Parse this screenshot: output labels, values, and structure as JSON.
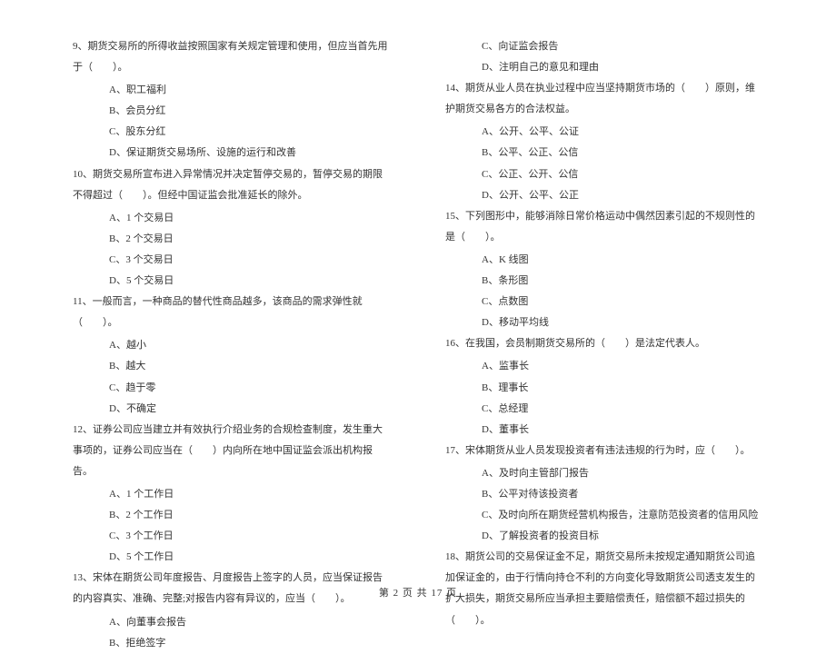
{
  "col1": {
    "q9": "9、期货交易所的所得收益按照国家有关规定管理和使用，但应当首先用于（　　）。",
    "q9a": "A、职工福利",
    "q9b": "B、会员分红",
    "q9c": "C、股东分红",
    "q9d": "D、保证期货交易场所、设施的运行和改善",
    "q10": "10、期货交易所宣布进入异常情况并决定暂停交易的，暂停交易的期限不得超过（　　）。但经中国证监会批准延长的除外。",
    "q10a": "A、1 个交易日",
    "q10b": "B、2 个交易日",
    "q10c": "C、3 个交易日",
    "q10d": "D、5 个交易日",
    "q11": "11、一般而言，一种商品的替代性商品越多，该商品的需求弹性就（　　）。",
    "q11a": "A、越小",
    "q11b": "B、越大",
    "q11c": "C、趋于零",
    "q11d": "D、不确定",
    "q12": "12、证券公司应当建立并有效执行介绍业务的合规检查制度，发生重大事项的，证券公司应当在（　　）内向所在地中国证监会派出机构报告。",
    "q12a": "A、1 个工作日",
    "q12b": "B、2 个工作日",
    "q12c": "C、3 个工作日",
    "q12d": "D、5 个工作日",
    "q13": "13、宋体在期货公司年度报告、月度报告上签字的人员，应当保证报告的内容真实、准确、完整;对报告内容有异议的，应当（　　）。",
    "q13a": "A、向董事会报告",
    "q13b": "B、拒绝签字"
  },
  "col2": {
    "q13c": "C、向证监会报告",
    "q13d": "D、注明自己的意见和理由",
    "q14": "14、期货从业人员在执业过程中应当坚持期货市场的（　　）原则，维护期货交易各方的合法权益。",
    "q14a": "A、公开、公平、公证",
    "q14b": "B、公平、公正、公信",
    "q14c": "C、公正、公开、公信",
    "q14d": "D、公开、公平、公正",
    "q15": "15、下列图形中，能够消除日常价格运动中偶然因素引起的不规则性的是（　　）。",
    "q15a": "A、K 线图",
    "q15b": "B、条形图",
    "q15c": "C、点数图",
    "q15d": "D、移动平均线",
    "q16": "16、在我国，会员制期货交易所的（　　）是法定代表人。",
    "q16a": "A、监事长",
    "q16b": "B、理事长",
    "q16c": "C、总经理",
    "q16d": "D、董事长",
    "q17": "17、宋体期货从业人员发现投资者有违法违规的行为时，应（　　）。",
    "q17a": "A、及时向主管部门报告",
    "q17b": "B、公平对待该投资者",
    "q17c": "C、及时向所在期货经营机构报告，注意防范投资者的信用风险",
    "q17d": "D、了解投资者的投资目标",
    "q18": "18、期货公司的交易保证金不足，期货交易所未按规定通知期货公司追加保证金的，由于行情向持仓不利的方向变化导致期货公司透支发生的扩大损失，期货交易所应当承担主要赔偿责任，赔偿额不超过损失的（　　）。"
  },
  "footer": "第 2 页 共 17 页"
}
